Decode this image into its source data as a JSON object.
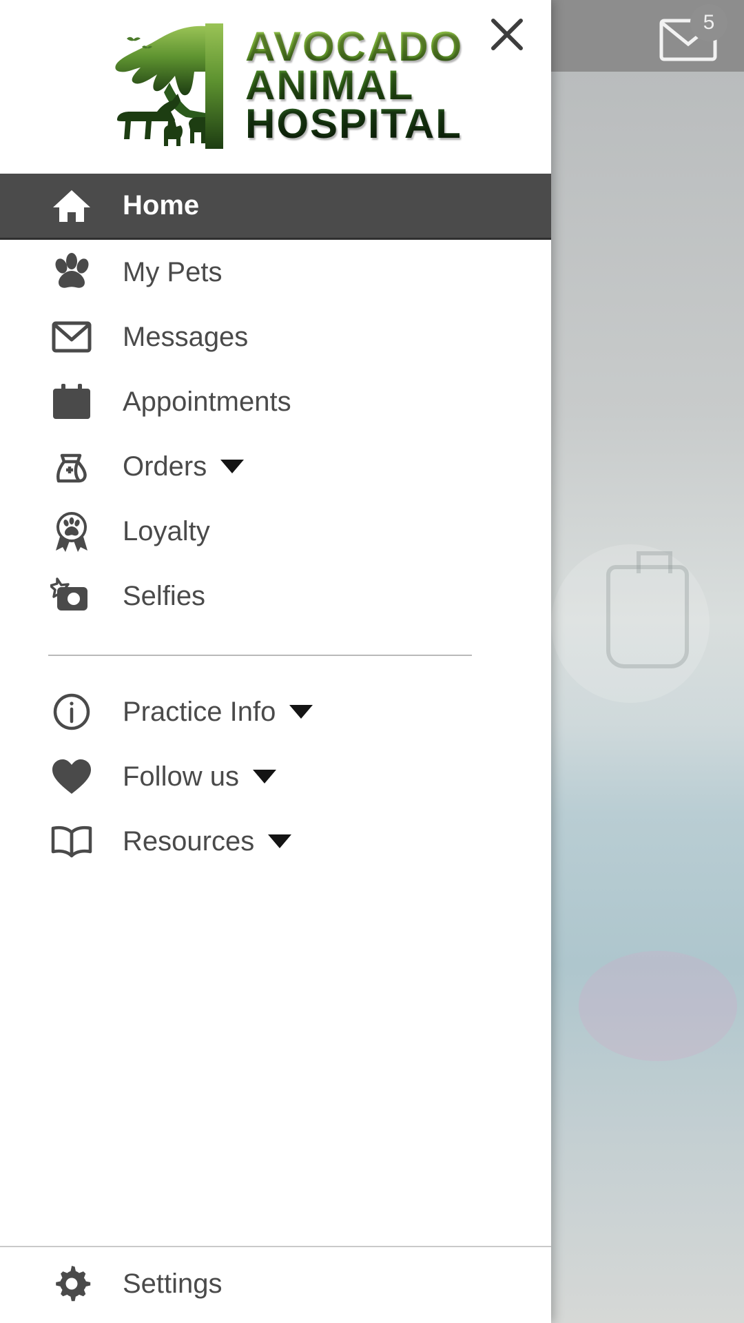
{
  "drawer": {
    "logo": {
      "line1": "AVOCADO",
      "line2": "ANIMAL",
      "line3": "HOSPITAL",
      "art_alt": "tree-with-animals-silhouette",
      "colors": {
        "light_green": "#8fbf4a",
        "mid_green": "#4d8a28",
        "dark_green": "#15330f"
      }
    },
    "close_label": "close-icon",
    "active_item": "Home",
    "active_bg": "#4b4b4b",
    "text_color": "#4a4a4a",
    "main_items": [
      {
        "label": "Home",
        "icon": "home-icon",
        "caret": false
      },
      {
        "label": "My Pets",
        "icon": "paw-icon",
        "caret": false
      },
      {
        "label": "Messages",
        "icon": "envelope-icon",
        "caret": false
      },
      {
        "label": "Appointments",
        "icon": "calendar-icon",
        "caret": false
      },
      {
        "label": "Orders",
        "icon": "food-bag-icon",
        "caret": true
      },
      {
        "label": "Loyalty",
        "icon": "award-paw-icon",
        "caret": false
      },
      {
        "label": "Selfies",
        "icon": "camera-star-icon",
        "caret": false
      }
    ],
    "secondary_items": [
      {
        "label": "Practice Info",
        "icon": "info-circle-icon",
        "caret": true
      },
      {
        "label": "Follow us",
        "icon": "heart-icon",
        "caret": true
      },
      {
        "label": "Resources",
        "icon": "book-icon",
        "caret": true
      }
    ],
    "footer_items": [
      {
        "label": "Settings",
        "icon": "gear-icon",
        "caret": false
      }
    ]
  },
  "background_app": {
    "mail_icon": "envelope-icon",
    "unread_badge": "5"
  }
}
